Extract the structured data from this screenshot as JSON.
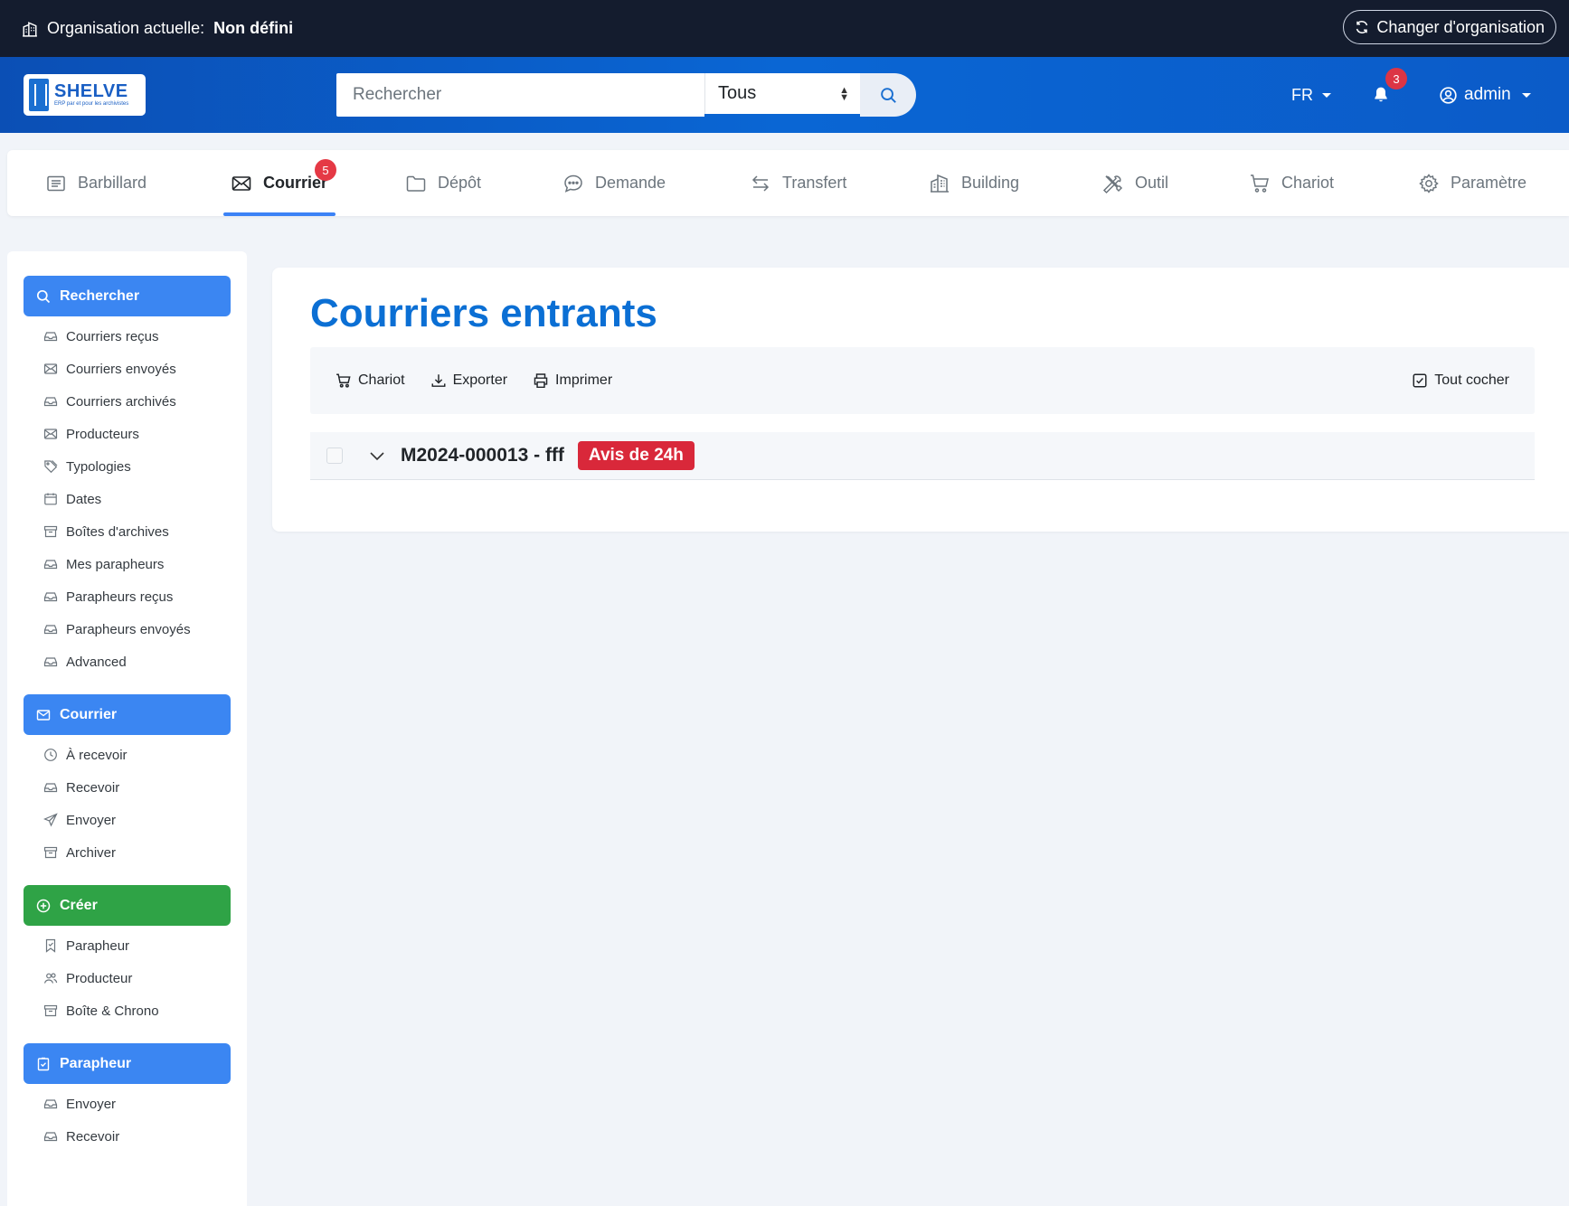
{
  "orgbar": {
    "label": "Organisation actuelle:",
    "value": "Non défini",
    "change_label": "Changer d'organisation"
  },
  "header": {
    "logo_title": "SHELVE",
    "logo_sub": "ERP par et pour les archivistes",
    "search_placeholder": "Rechercher",
    "search_scope": "Tous",
    "lang": "FR",
    "notifications_count": "3",
    "user": "admin"
  },
  "tabs": [
    {
      "label": "Barbillard",
      "icon": "list-icon"
    },
    {
      "label": "Courrier",
      "icon": "envelope-icon",
      "badge": "5",
      "active": true
    },
    {
      "label": "Dépôt",
      "icon": "folder-icon"
    },
    {
      "label": "Demande",
      "icon": "chat-icon"
    },
    {
      "label": "Transfert",
      "icon": "arrows-icon"
    },
    {
      "label": "Building",
      "icon": "building-icon"
    },
    {
      "label": "Outil",
      "icon": "tools-icon"
    },
    {
      "label": "Chariot",
      "icon": "cart-icon"
    },
    {
      "label": "Paramètre",
      "icon": "gear-icon"
    }
  ],
  "sidebar": {
    "search": {
      "title": "Rechercher",
      "items": [
        "Courriers reçus",
        "Courriers envoyés",
        "Courriers archivés",
        "Producteurs",
        "Typologies",
        "Dates",
        "Boîtes d'archives",
        "Mes parapheurs",
        "Parapheurs reçus",
        "Parapheurs envoyés",
        "Advanced"
      ]
    },
    "courrier": {
      "title": "Courrier",
      "items": [
        "À recevoir",
        "Recevoir",
        "Envoyer",
        "Archiver"
      ]
    },
    "creer": {
      "title": "Créer",
      "items": [
        "Parapheur",
        "Producteur",
        "Boîte & Chrono"
      ]
    },
    "parapheur": {
      "title": "Parapheur",
      "items": [
        "Envoyer",
        "Recevoir"
      ]
    }
  },
  "main": {
    "title": "Courriers entrants",
    "toolbar": {
      "cart": "Chariot",
      "export": "Exporter",
      "print": "Imprimer",
      "check_all": "Tout cocher"
    },
    "rows": [
      {
        "ref": "M2024-000013 - fff",
        "badge": "Avis de 24h"
      }
    ]
  },
  "colors": {
    "primary": "#0b6fd4",
    "sidebar_blue": "#3b86f2",
    "sidebar_green": "#2fa346",
    "danger": "#d9283a",
    "topbar": "#141c2e"
  }
}
